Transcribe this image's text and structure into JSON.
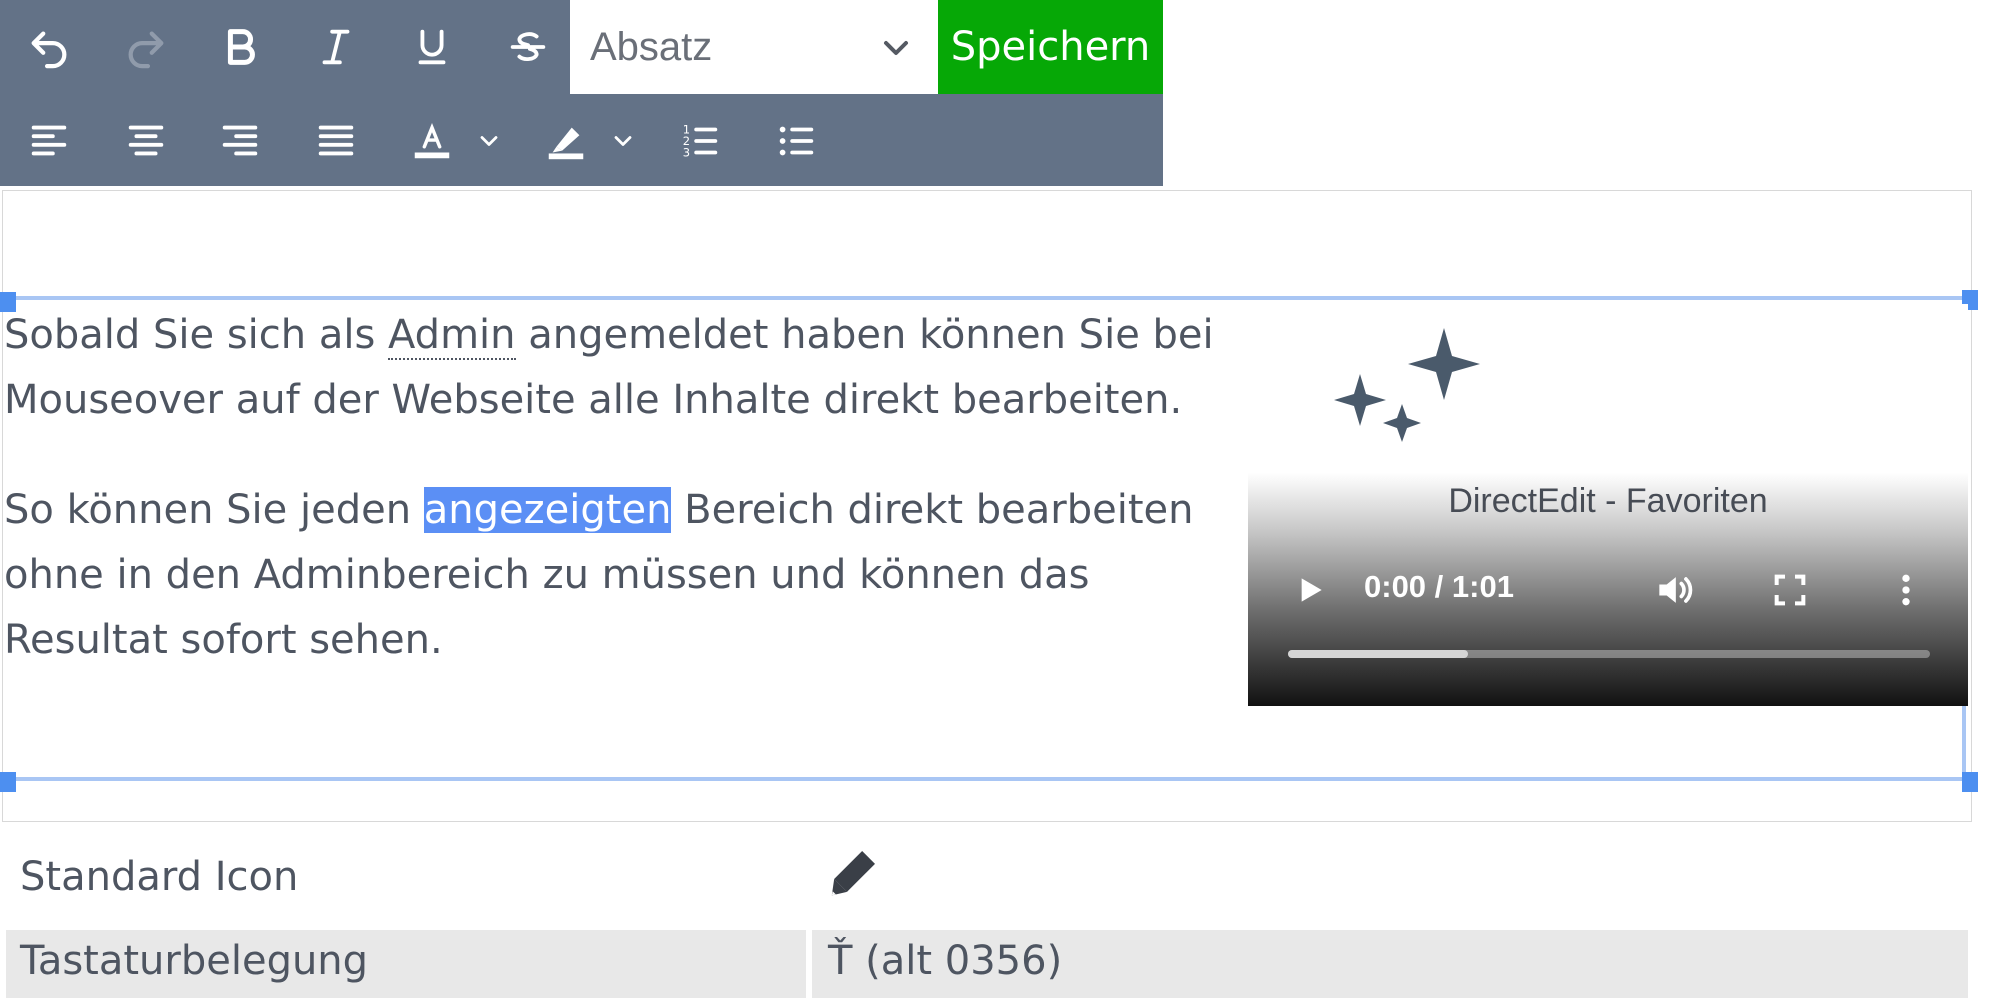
{
  "toolbar": {
    "format_select": "Absatz",
    "save_label": "Speichern",
    "buttons": [
      "undo-icon",
      "redo-icon",
      "bold-icon",
      "italic-icon",
      "underline-icon",
      "strikethrough-icon",
      "align-left-icon",
      "align-center-icon",
      "align-right-icon",
      "align-justify-icon",
      "text-color-icon",
      "chevron-down-icon",
      "highlight-color-icon",
      "chevron-down-icon",
      "numbered-list-icon",
      "bullet-list-icon"
    ],
    "colors": {
      "background": "#637287",
      "save": "#06a806"
    }
  },
  "content": {
    "p1_before": "Sobald Sie sich als ",
    "p1_abbr": "Admin",
    "p1_after": " angemeldet haben können Sie bei Mouseover auf der Webseite alle Inhalte direkt bearbeiten.",
    "p2_before": "So können Sie jeden ",
    "p2_selected": "angezeigten",
    "p2_after": " Bereich direkt bearbeiten ohne in den Adminbereich zu müssen und können das Resultat sofort sehen.",
    "selection_color": "#5b8ff5"
  },
  "video": {
    "title": "DirectEdit - Favoriten",
    "time": "0:00 / 1:01",
    "buffered_fraction": 0.28,
    "controls": [
      "play-icon",
      "volume-icon",
      "fullscreen-icon",
      "more-icon"
    ]
  },
  "properties": [
    {
      "label": "Standard Icon",
      "value_icon": "pencil-icon"
    },
    {
      "label": "Tastaturbelegung",
      "value": "Ť (alt 0356)"
    }
  ]
}
